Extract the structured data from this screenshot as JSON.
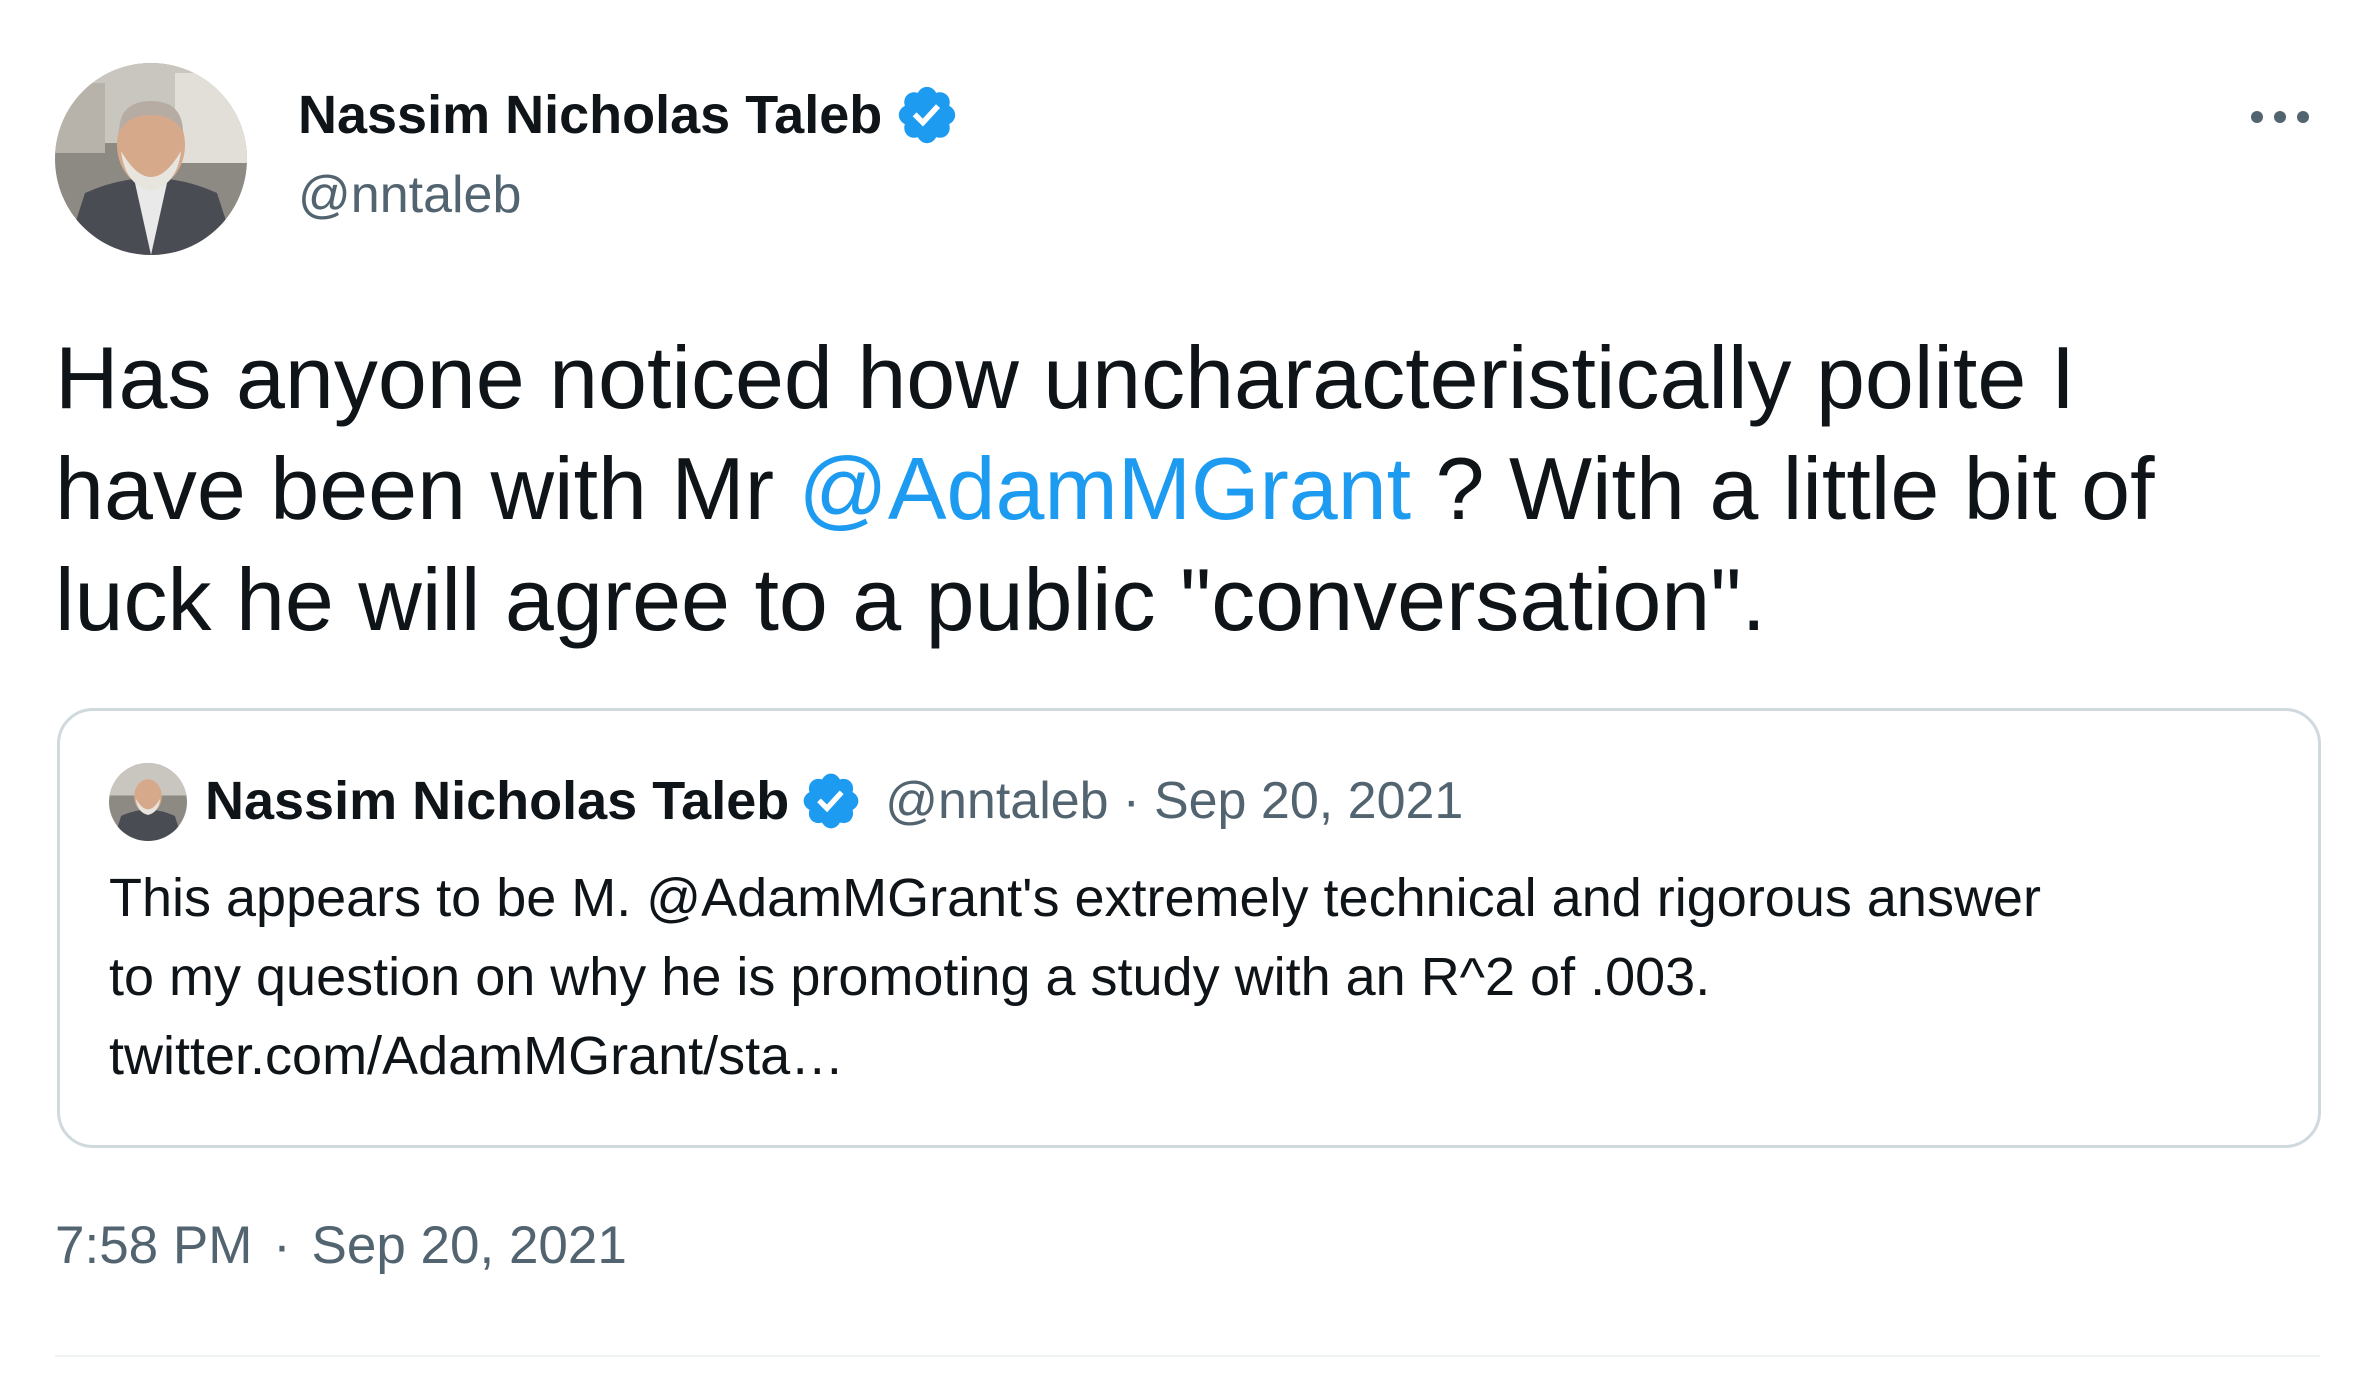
{
  "author": {
    "display_name": "Nassim Nicholas Taleb",
    "handle": "@nntaleb",
    "verified": true,
    "avatar_icon": "profile-photo-icon",
    "verified_icon": "verified-badge-icon"
  },
  "more_icon": "more-options-icon",
  "tweet": {
    "text_part1": "Has anyone noticed how uncharacteristically polite I",
    "text_part2": "have been with Mr ",
    "mention": "@AdamMGrant",
    "text_part3": " ? With a little bit of",
    "text_part4": "luck he will agree to a public \"conversation\"."
  },
  "quoted_tweet": {
    "display_name": "Nassim Nicholas Taleb",
    "handle": "@nntaleb",
    "separator": "·",
    "date": "Sep 20, 2021",
    "line1": "This appears to be M. @AdamMGrant's extremely technical and rigorous answer",
    "line2": "to my question on why he is promoting a study with an R^2 of .003.",
    "line3": "twitter.com/AdamMGrant/sta…"
  },
  "timestamp": {
    "time": "7:58 PM",
    "separator": "·",
    "date": "Sep 20, 2021"
  },
  "colors": {
    "accent": "#1d9bf0",
    "text_primary": "#0f1419",
    "text_secondary": "#536471",
    "border": "#cfd9de"
  }
}
